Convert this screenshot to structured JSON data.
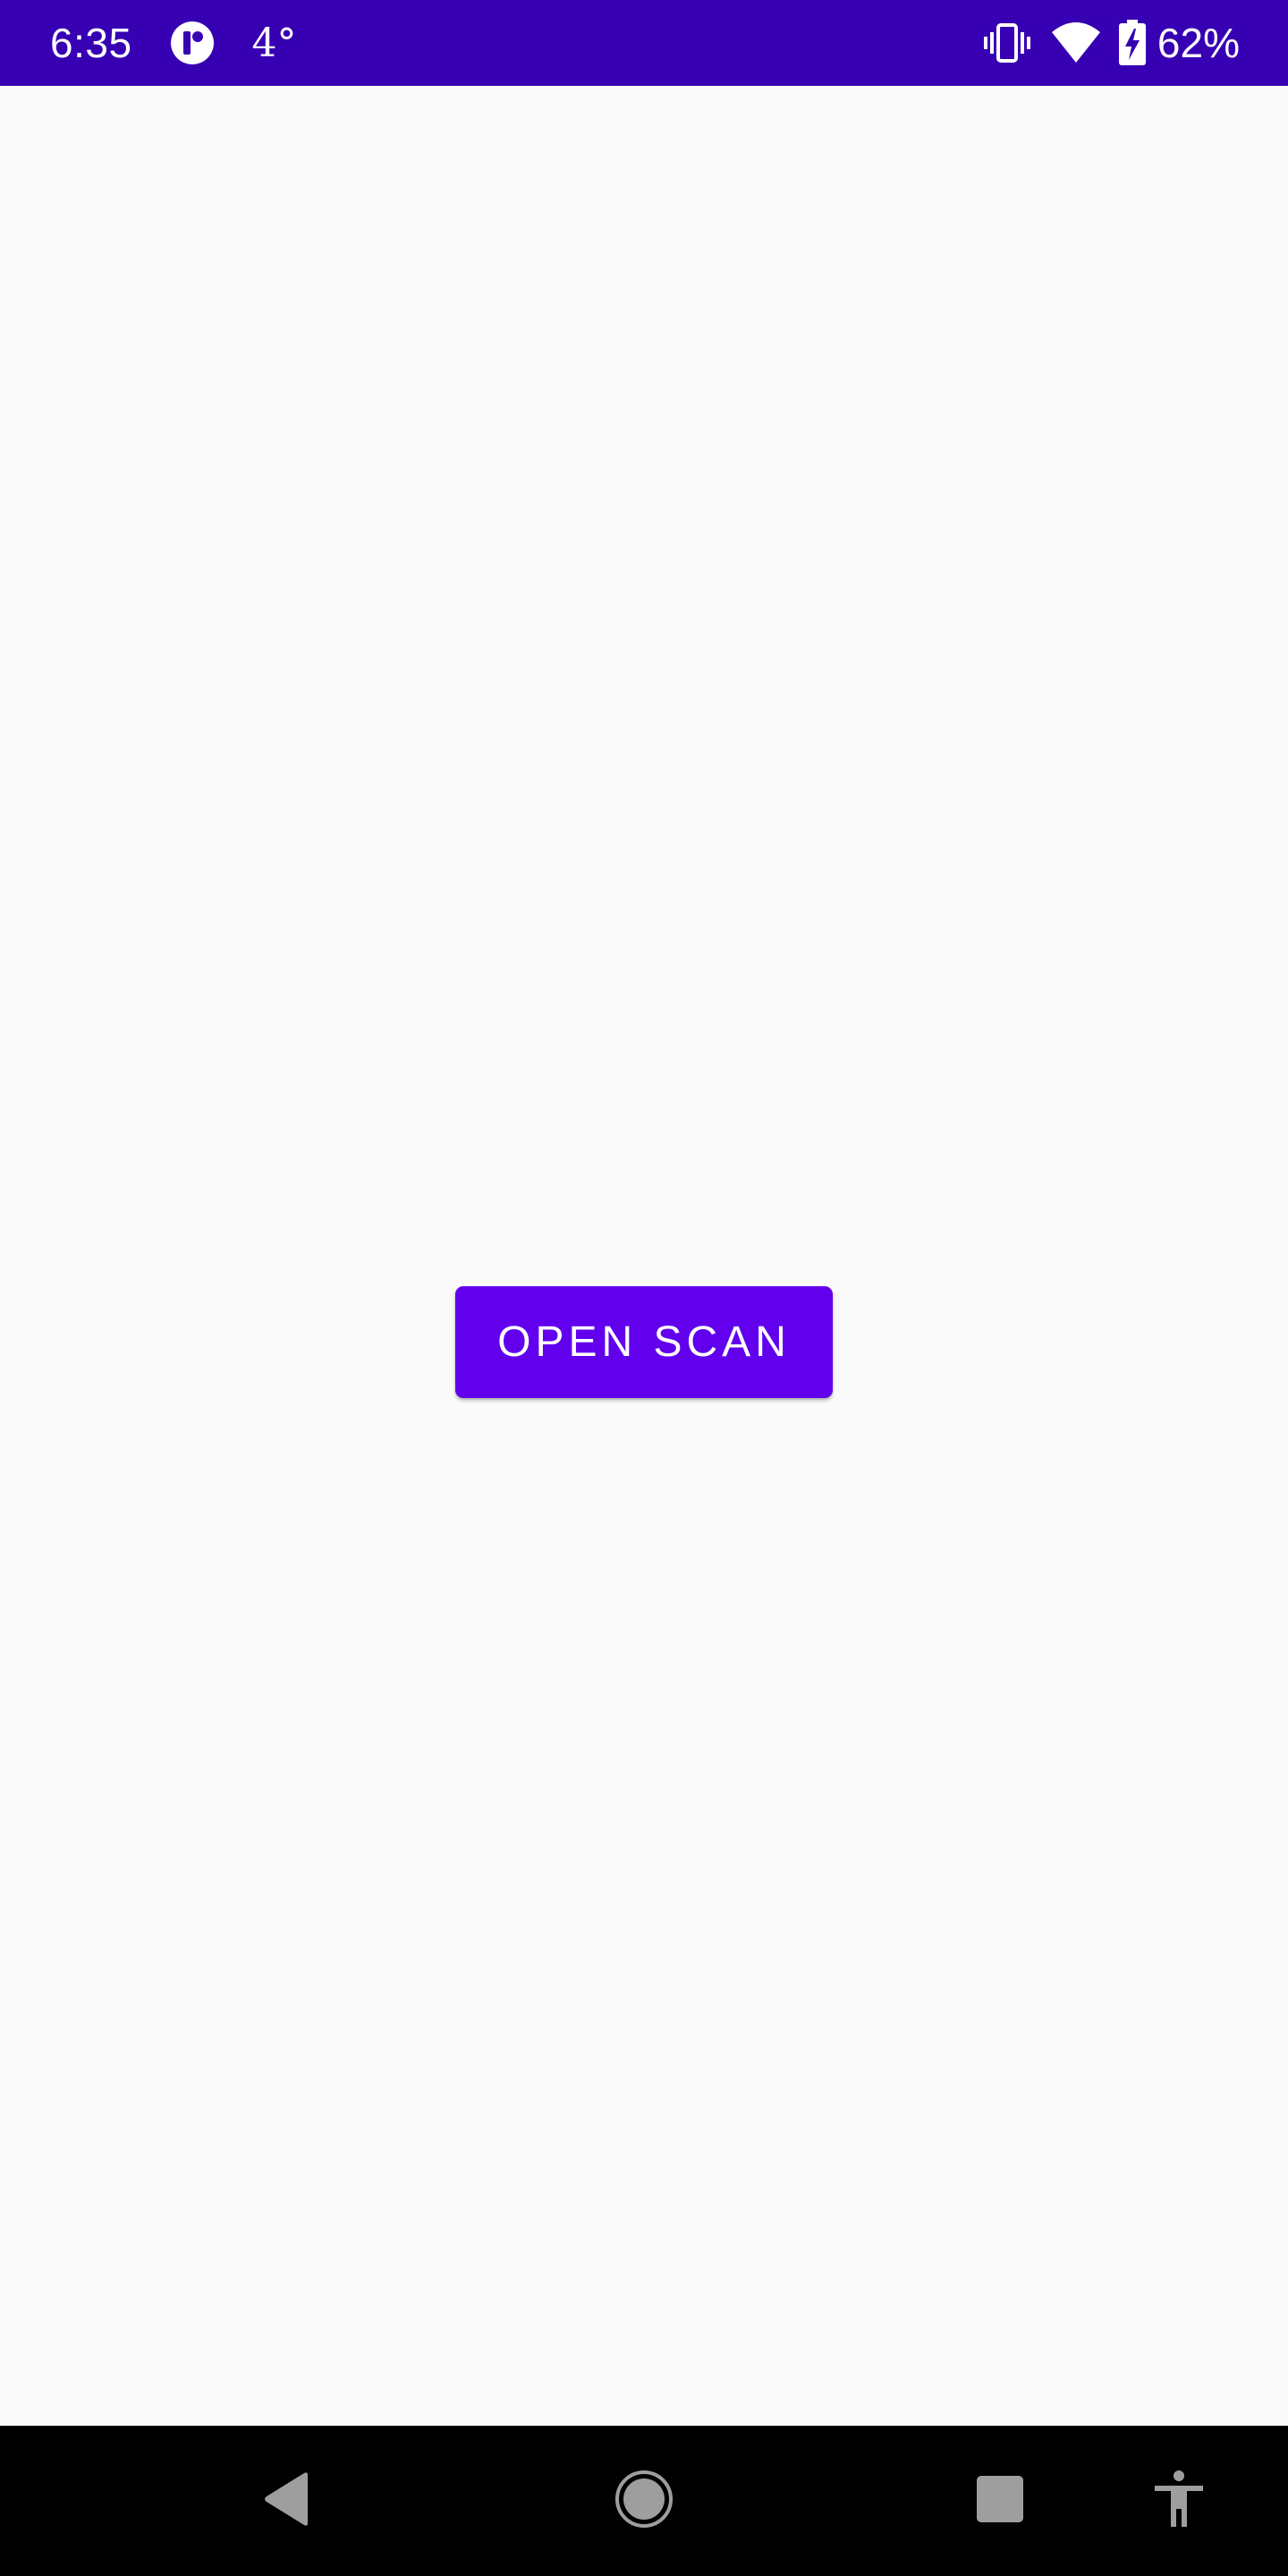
{
  "status_bar": {
    "time": "6:35",
    "temperature": "4°",
    "battery_percent": "62%",
    "background_color": "#3700B3",
    "icons": [
      "app-notification-icon",
      "vibrate-icon",
      "wifi-icon",
      "battery-charging-icon"
    ]
  },
  "main": {
    "open_scan_label": "OPEN SCAN",
    "button_color": "#6200EE",
    "background_color": "#FAFAFA"
  },
  "nav_bar": {
    "icons": [
      "back-icon",
      "home-icon",
      "recents-icon",
      "accessibility-icon"
    ]
  }
}
